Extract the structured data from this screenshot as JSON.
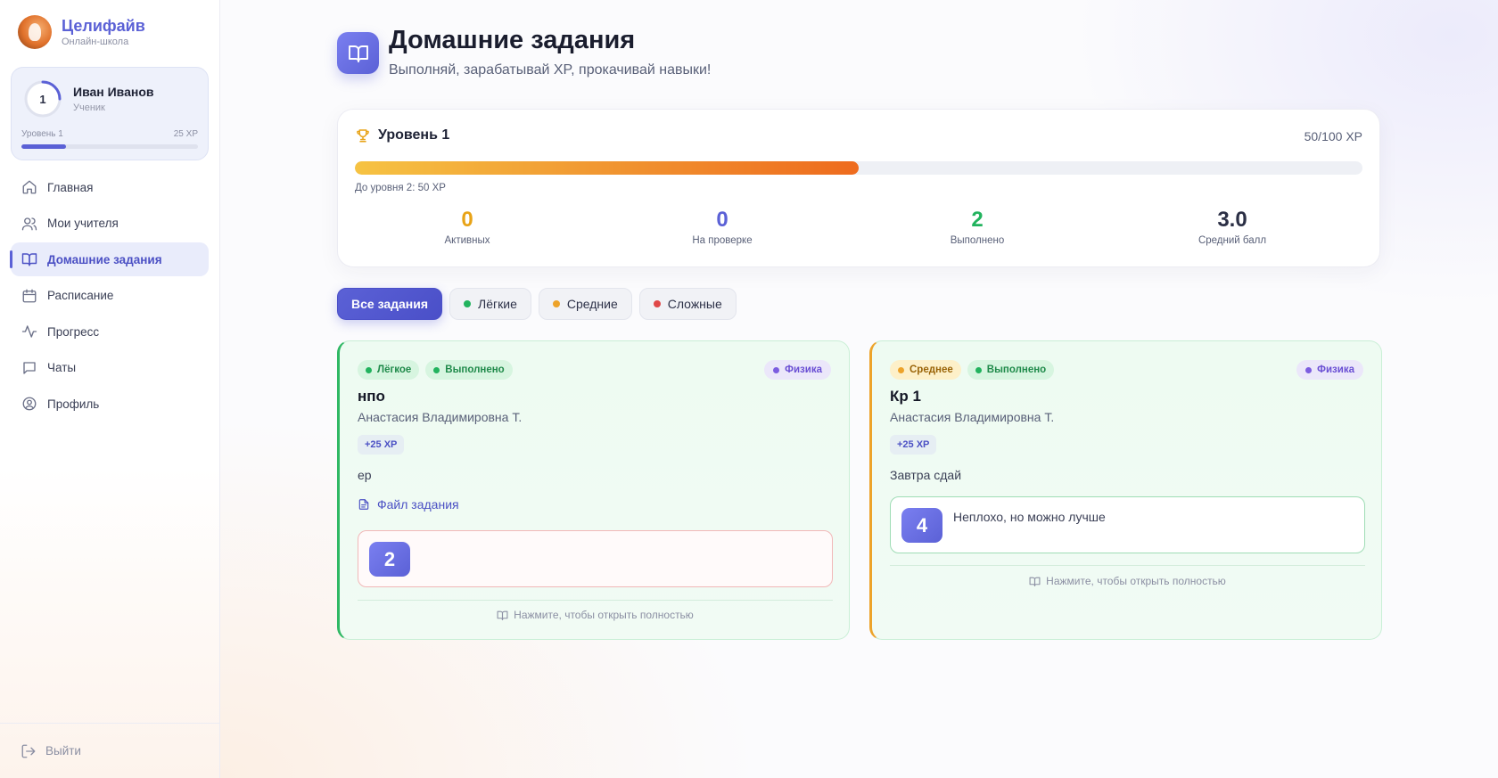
{
  "brand": {
    "name": "Целифайв",
    "subtitle": "Онлайн-школа"
  },
  "user": {
    "name": "Иван Иванов",
    "role": "Ученик",
    "level_num": "1",
    "level_label": "Уровень 1",
    "xp_label": "25 XP",
    "level_progress": 0.25
  },
  "nav": {
    "items": [
      {
        "label": "Главная",
        "icon": "home-icon",
        "active": false
      },
      {
        "label": "Мои учителя",
        "icon": "users-icon",
        "active": false
      },
      {
        "label": "Домашние задания",
        "icon": "book-icon",
        "active": true
      },
      {
        "label": "Расписание",
        "icon": "calendar-icon",
        "active": false
      },
      {
        "label": "Прогресс",
        "icon": "activity-icon",
        "active": false
      },
      {
        "label": "Чаты",
        "icon": "chat-icon",
        "active": false
      },
      {
        "label": "Профиль",
        "icon": "profile-icon",
        "active": false
      }
    ],
    "logout": "Выйти"
  },
  "header": {
    "title": "Домашние задания",
    "subtitle": "Выполняй, зарабатывай XP, прокачивай навыки!"
  },
  "level_card": {
    "title": "Уровень 1",
    "xp": "50/100 XP",
    "progress": 0.5,
    "next_level": "До уровня 2: 50 XP",
    "stats": [
      {
        "value": "0",
        "label": "Активных",
        "color": "#e8a317"
      },
      {
        "value": "0",
        "label": "На проверке",
        "color": "#5b61d6"
      },
      {
        "value": "2",
        "label": "Выполнено",
        "color": "#22b35e"
      },
      {
        "value": "3.0",
        "label": "Средний балл",
        "color": "#2b2f45"
      }
    ]
  },
  "filters": [
    {
      "label": "Все задания",
      "active": true,
      "dot": ""
    },
    {
      "label": "Лёгкие",
      "active": false,
      "dot": "#22b35e"
    },
    {
      "label": "Средние",
      "active": false,
      "dot": "#eda32a"
    },
    {
      "label": "Сложные",
      "active": false,
      "dot": "#e04848"
    }
  ],
  "tasks": [
    {
      "difficulty": "Лёгкое",
      "status": "Выполнено",
      "subject": "Физика",
      "title": "нпо",
      "teacher": "Анастасия Владимировна Т.",
      "xp": "+25 XP",
      "description": "ер",
      "file": "Файл задания",
      "grade": "2",
      "comment": "",
      "hint": "Нажмите, чтобы открыть полностью"
    },
    {
      "difficulty": "Среднее",
      "status": "Выполнено",
      "subject": "Физика",
      "title": "Кр 1",
      "teacher": "Анастасия Владимировна Т.",
      "xp": "+25 XP",
      "description": "Завтра сдай",
      "file": "",
      "grade": "4",
      "comment": "Неплохо, но можно лучше",
      "hint": "Нажмите, чтобы открыть полностью"
    }
  ],
  "colors": {
    "accent": "#5b61d6",
    "easy": "#22b35e",
    "medium": "#eda32a",
    "hard": "#e04848"
  }
}
